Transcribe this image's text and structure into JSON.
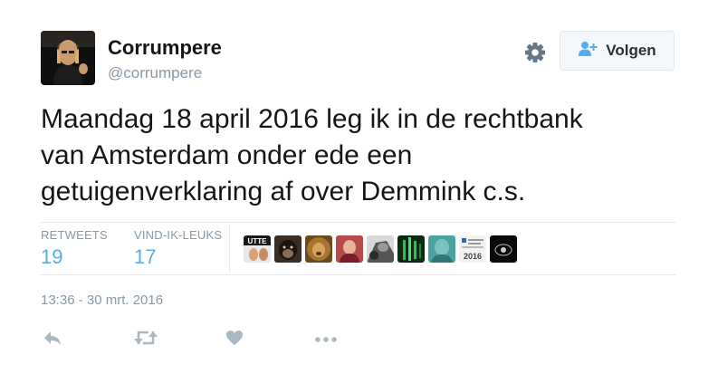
{
  "user": {
    "name": "Corrumpere",
    "handle": "@corrumpere",
    "avatar_icon": "profile-photo"
  },
  "header": {
    "settings_icon": "gear-icon",
    "follow_icon": "add-user-icon",
    "follow_label": "Volgen"
  },
  "tweet": {
    "text": "Maandag 18 april 2016 leg ik in de rechtbank\nvan Amsterdam onder ede een\ngetuigenverklaring af over Demmink c.s."
  },
  "stats": {
    "retweets_label": "RETWEETS",
    "retweets_count": "19",
    "likes_label": "VIND-IK-LEUKS",
    "likes_count": "17"
  },
  "likers": [
    {
      "name": "liker-avatar-utte",
      "text": "UTTE"
    },
    {
      "name": "liker-avatar-chimp",
      "text": ""
    },
    {
      "name": "liker-avatar-lion",
      "text": ""
    },
    {
      "name": "liker-avatar-portrait",
      "text": ""
    },
    {
      "name": "liker-avatar-bw",
      "text": ""
    },
    {
      "name": "liker-avatar-green",
      "text": ""
    },
    {
      "name": "liker-avatar-teal",
      "text": ""
    },
    {
      "name": "liker-avatar-2016",
      "text": "2016"
    },
    {
      "name": "liker-avatar-dark",
      "text": ""
    }
  ],
  "meta": {
    "timestamp": "13:36 - 30 mrt. 2016"
  },
  "actions": [
    {
      "name": "reply-icon"
    },
    {
      "name": "retweet-icon"
    },
    {
      "name": "like-icon"
    },
    {
      "name": "more-icon"
    }
  ],
  "colors": {
    "accent": "#55acee",
    "secondary_text": "#8899a6",
    "border": "#e1e8ed",
    "action_icon": "#aab8c2"
  }
}
